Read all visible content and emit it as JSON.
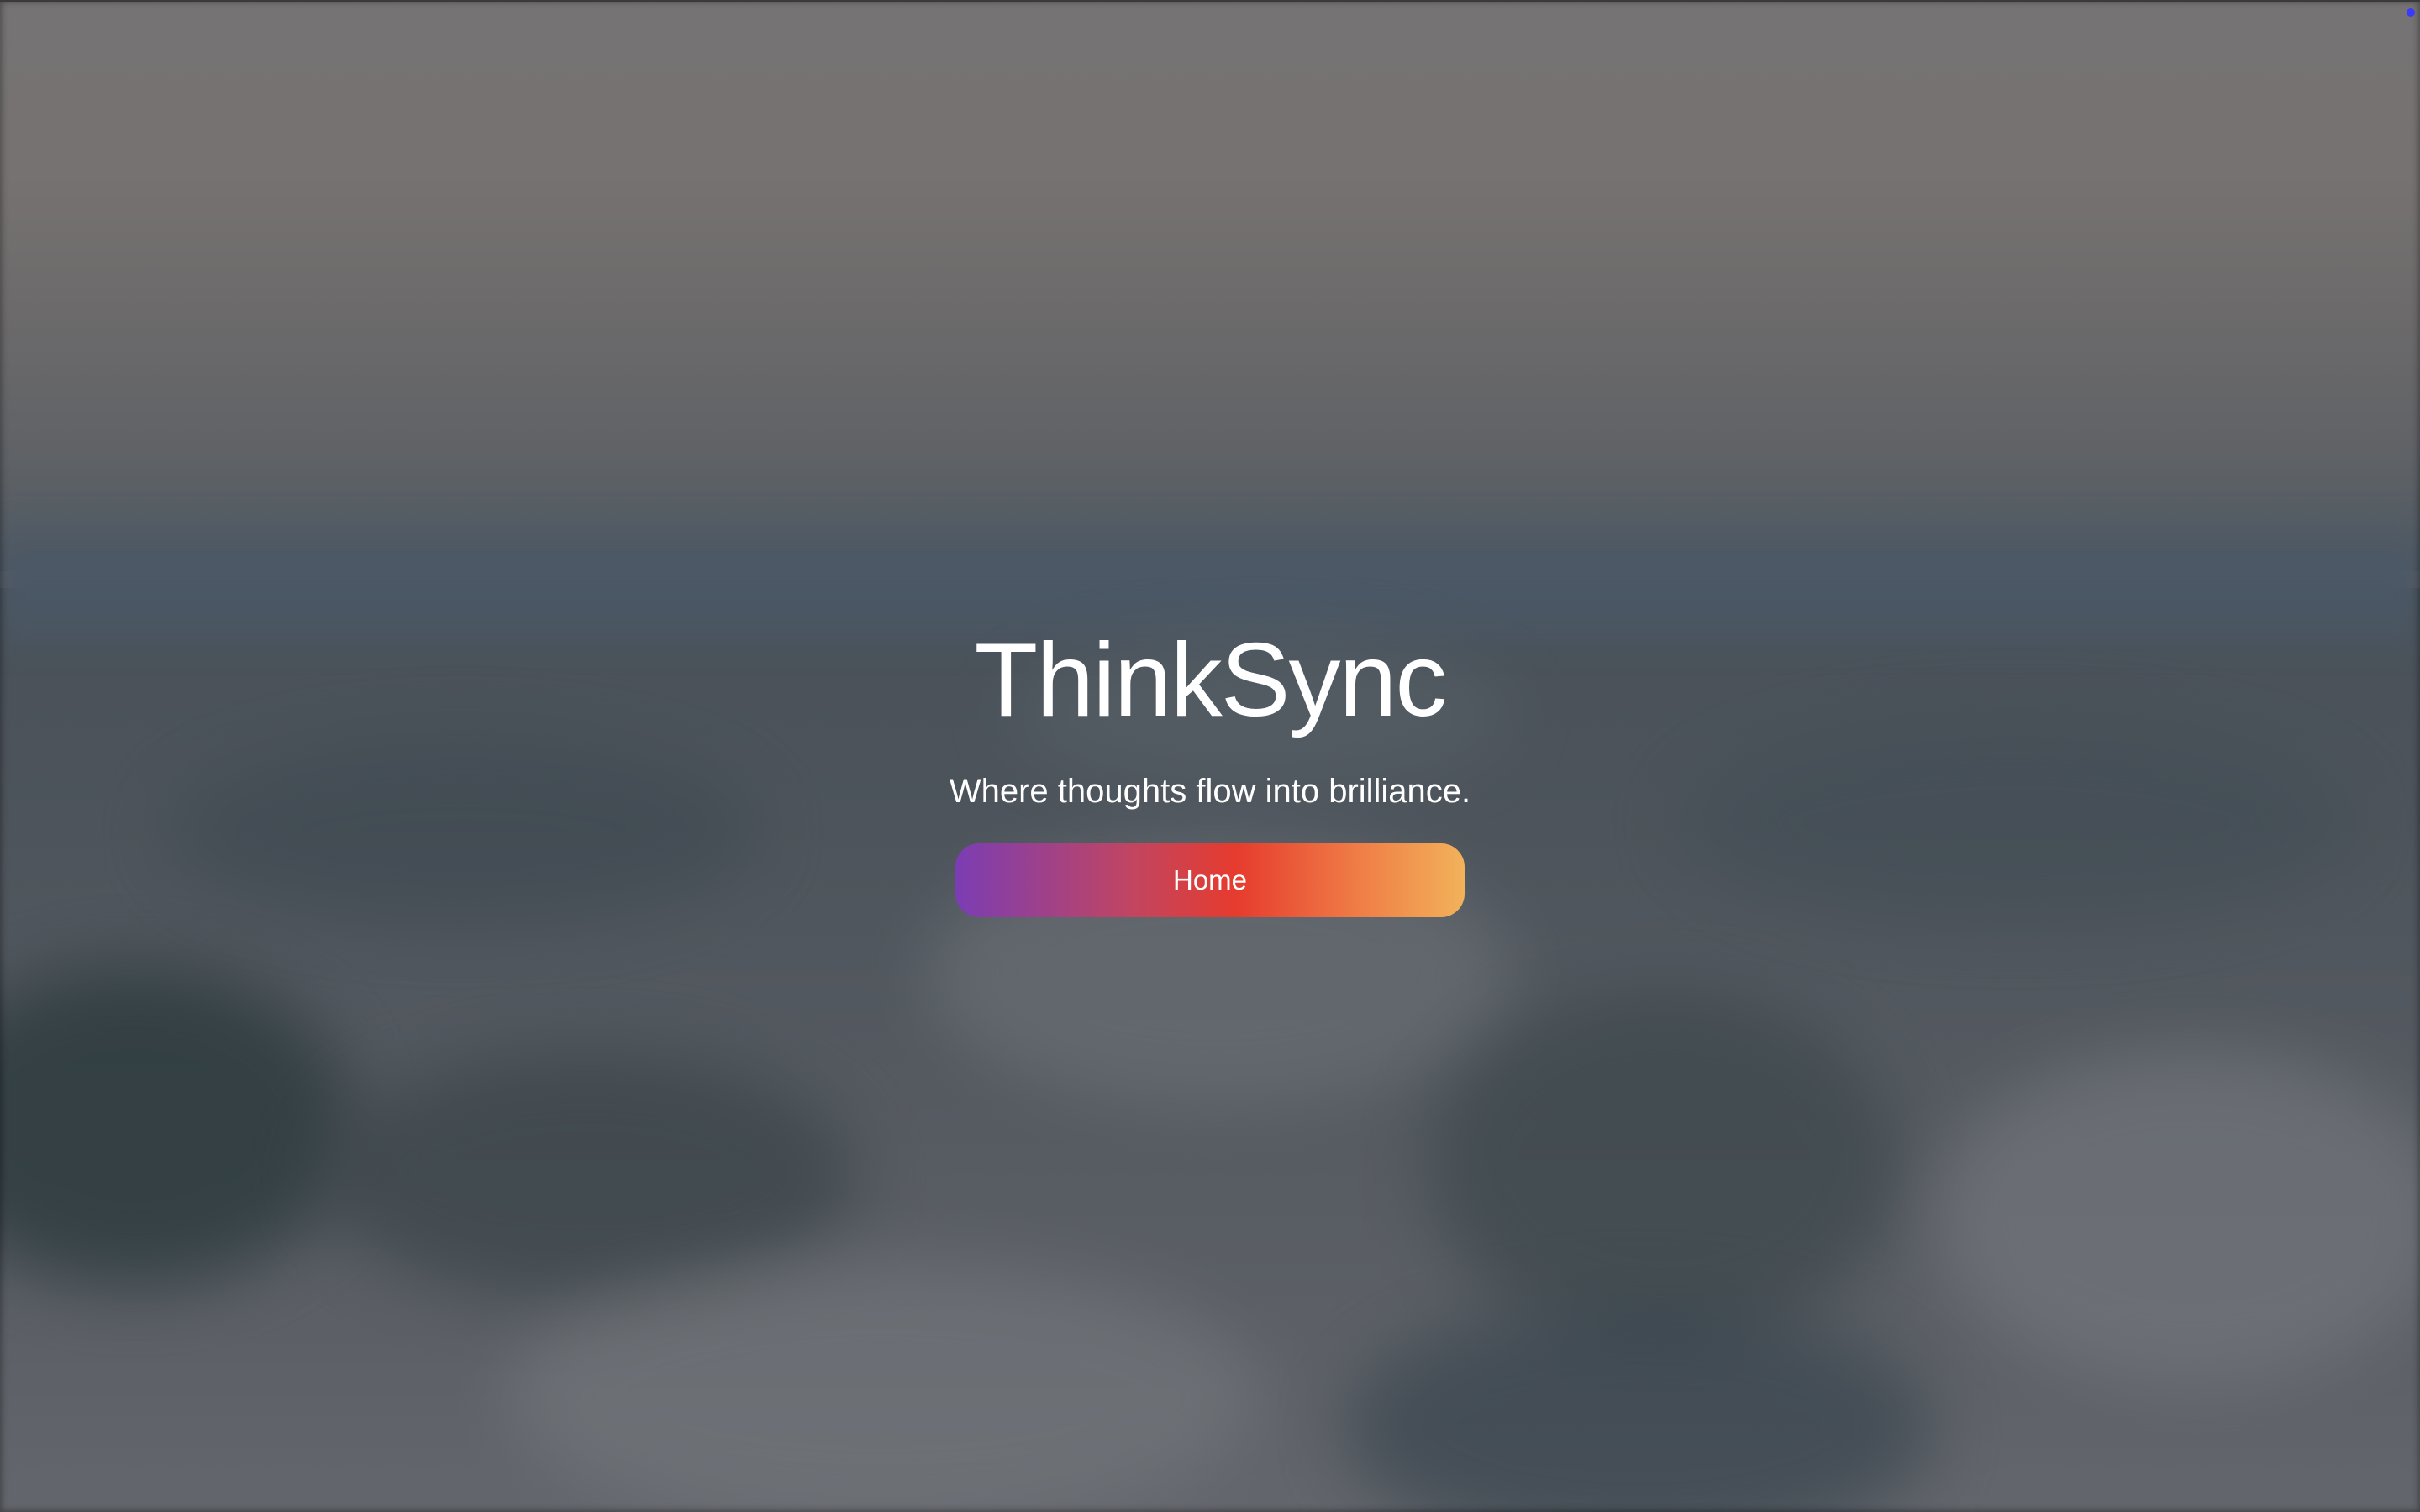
{
  "hero": {
    "title": "ThinkSync",
    "tagline": "Where thoughts flow into brilliance.",
    "home_button_label": "Home"
  },
  "colors": {
    "button_gradient": [
      "#7b3db3",
      "#c24560",
      "#e63b2e",
      "#ef7a45",
      "#f2b25a"
    ],
    "text": "#ffffff"
  }
}
